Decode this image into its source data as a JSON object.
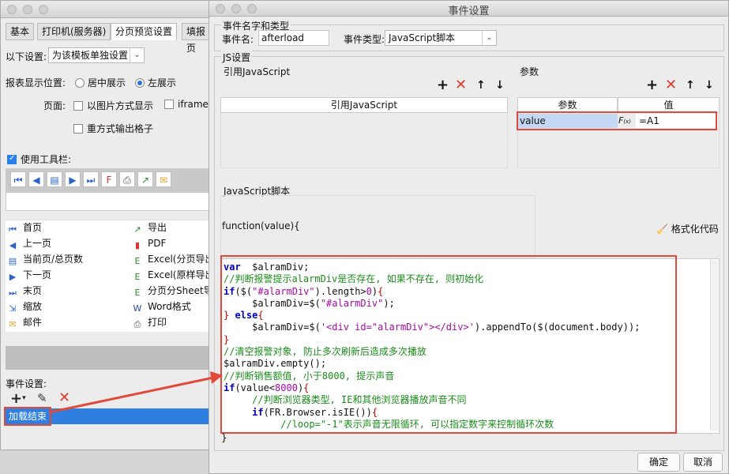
{
  "left_window": {
    "tabs": [
      "基本",
      "打印机(服务器)",
      "分页预览设置",
      "填报页"
    ],
    "setting_label": "以下设置:",
    "setting_value": "为该模板单独设置",
    "report_position_label": "报表显示位置:",
    "pos_center": "居中展示",
    "pos_left": "左展示",
    "page_label": "页面:",
    "opt_image_print": "以图片方式显示",
    "opt_iframe": "iframe",
    "opt_repeat": "重方式输出格子",
    "use_toolbar": "使用工具栏:",
    "toolbar_buttons": [
      {
        "label": "首页",
        "icon": "first-page-icon"
      },
      {
        "label": "导出",
        "icon": "export-icon"
      },
      {
        "label": "上一页",
        "icon": "prev-page-icon"
      },
      {
        "label": "PDF",
        "icon": "pdf-icon"
      },
      {
        "label": "当前页/总页数",
        "icon": "page-count-icon"
      },
      {
        "label": "Excel(分页导出",
        "icon": "excel-icon"
      },
      {
        "label": "下一页",
        "icon": "next-page-icon"
      },
      {
        "label": "Excel(原样导出",
        "icon": "excel-icon"
      },
      {
        "label": "末页",
        "icon": "last-page-icon"
      },
      {
        "label": "分页分Sheet导",
        "icon": "excel-icon"
      },
      {
        "label": "缩放",
        "icon": "zoom-icon"
      },
      {
        "label": "Word格式",
        "icon": "word-icon"
      },
      {
        "label": "邮件",
        "icon": "mail-icon"
      },
      {
        "label": "打印",
        "icon": "print-icon"
      }
    ],
    "event_setting": "事件设置:",
    "event_item": "加载结束"
  },
  "dialog": {
    "title": "事件设置",
    "name_type_section": "事件名字和类型",
    "event_name_label": "事件名:",
    "event_name_value": "afterload",
    "event_type_label": "事件类型:",
    "event_type_value": "JavaScript脚本",
    "js_section": "JS设置",
    "ref_js_label": "引用JavaScript",
    "ref_js_header": "引用JavaScript",
    "params_label": "参数",
    "params_header_param": "参数",
    "params_header_value": "值",
    "param_name": "value",
    "param_value": "=A1",
    "script_label": "JavaScript脚本",
    "function_sig": "function(value){",
    "format_code": "格式化代码",
    "code_close": "}",
    "ok": "确定",
    "cancel": "取消",
    "code_lines": [
      [
        [
          "kw",
          "var"
        ],
        [
          "",
          "  $alramDiv;"
        ]
      ],
      [
        [
          "cm",
          "//判断报警提示alarmDiv是否存在, 如果不存在, 则初始化"
        ]
      ],
      [
        [
          "kw",
          "if"
        ],
        [
          "",
          "($("
        ],
        [
          "st",
          "\"#alarmDiv\""
        ],
        [
          "",
          ").length>"
        ],
        [
          "st",
          "0"
        ],
        [
          "",
          ")"
        ],
        [
          "rd",
          "{"
        ]
      ],
      [
        [
          "",
          "     $alramDiv=$("
        ],
        [
          "st",
          "\"#alarmDiv\""
        ],
        [
          "",
          ");"
        ]
      ],
      [
        [
          "rd",
          "}"
        ],
        [
          "kw",
          " else"
        ],
        [
          "rd",
          "{"
        ]
      ],
      [
        [
          "",
          "     $alramDiv=$("
        ],
        [
          "st",
          "'<div id=\"alarmDiv\"></div>'"
        ],
        [
          "",
          ").appendTo($(document.body));"
        ]
      ],
      [
        [
          "rd",
          "}"
        ]
      ],
      [
        [
          "cm",
          "//清空报警对象, 防止多次刷新后造成多次播放"
        ]
      ],
      [
        [
          "",
          "$alramDiv.empty();"
        ]
      ],
      [
        [
          "cm",
          "//判断销售额值, 小于8000, 提示声音"
        ]
      ],
      [
        [
          "kw",
          "if"
        ],
        [
          "",
          "(value<"
        ],
        [
          "st",
          "8000"
        ],
        [
          "",
          ")"
        ],
        [
          "rd",
          "{"
        ]
      ],
      [
        [
          "cm",
          "     //判断浏览器类型, IE和其他浏览器播放声音不同"
        ]
      ],
      [
        [
          "kw",
          "     if"
        ],
        [
          "",
          "(FR.Browser.isIE())"
        ],
        [
          "rd",
          "{"
        ]
      ],
      [
        [
          "cm",
          "          //loop=\"-1\"表示声音无限循环, 可以指定数字来控制循环次数"
        ]
      ]
    ]
  }
}
